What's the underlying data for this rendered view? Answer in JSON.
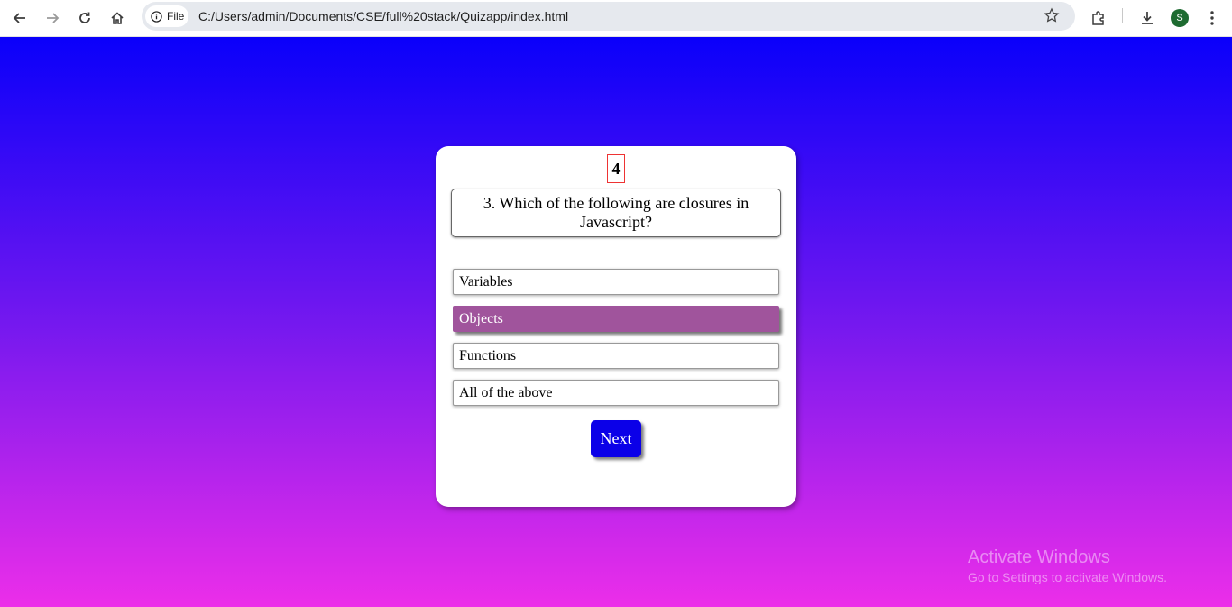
{
  "browser": {
    "file_label": "File",
    "url": "C:/Users/admin/Documents/CSE/full%20stack/Quizapp/index.html",
    "profile_initial": "S"
  },
  "quiz": {
    "timer": "4",
    "question": "3. Which of the following are closures in Javascript?",
    "options": [
      {
        "label": "Variables"
      },
      {
        "label": "Objects"
      },
      {
        "label": "Functions"
      },
      {
        "label": "All of the above"
      }
    ],
    "selected_option": "Objects",
    "next_label": "Next"
  },
  "watermark": {
    "title": "Activate Windows",
    "subtitle": "Go to Settings to activate Windows."
  },
  "colors": {
    "gradient_top": "#0a00fa",
    "gradient_bottom": "#ec2ee9",
    "selected_option": "#a0549c",
    "next_button": "#0b00e8"
  }
}
